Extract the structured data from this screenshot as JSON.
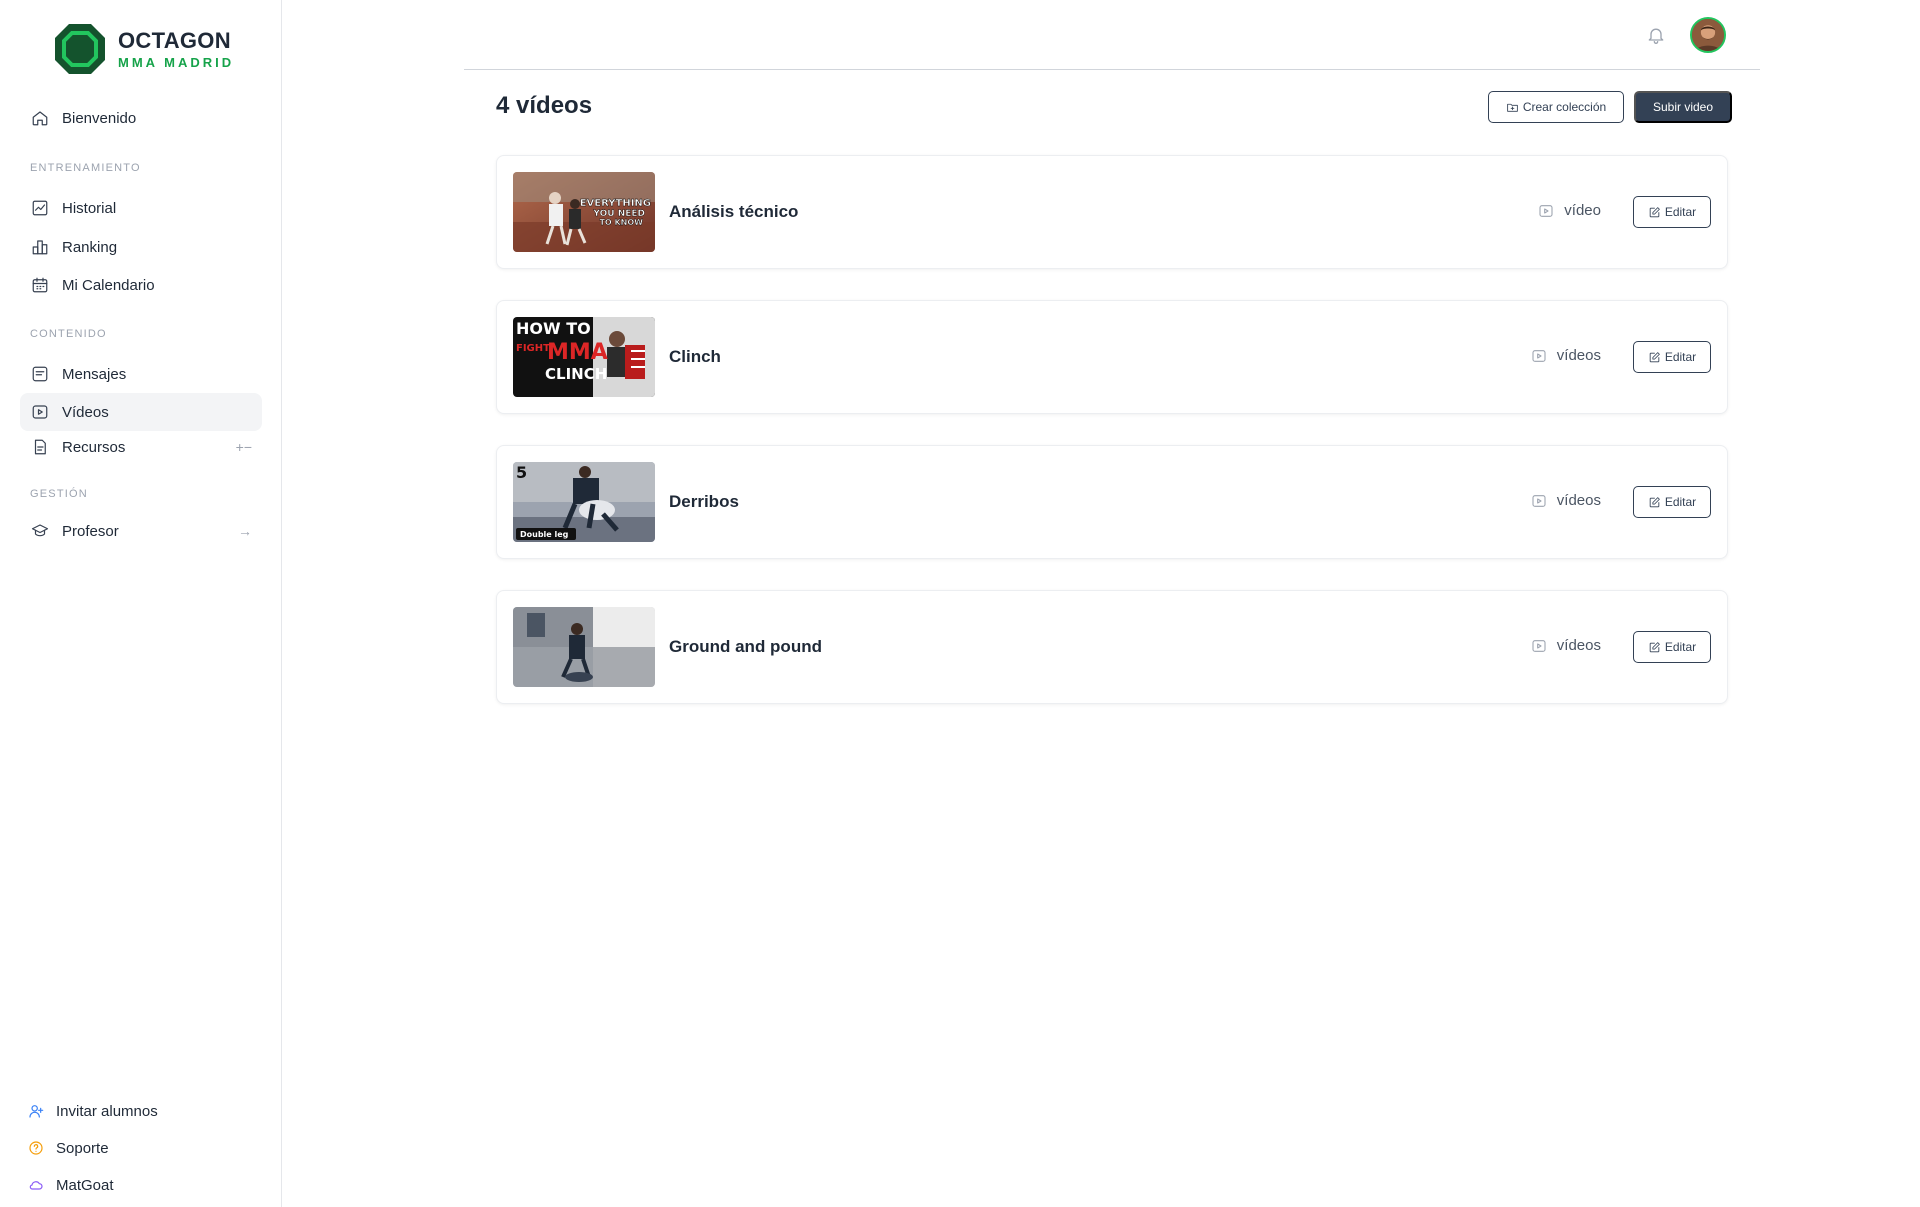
{
  "brand": {
    "title": "OCTAGON",
    "subtitle": "MMA MADRID",
    "accent": "#16a34a"
  },
  "sidebar": {
    "home": {
      "label": "Bienvenido",
      "icon": "home-icon"
    },
    "sections": [
      {
        "label": "ENTRENAMIENTO",
        "items": [
          {
            "label": "Historial",
            "icon": "chart-icon"
          },
          {
            "label": "Ranking",
            "icon": "ranking-icon"
          },
          {
            "label": "Mi Calendario",
            "icon": "calendar-icon"
          }
        ]
      },
      {
        "label": "CONTENIDO",
        "items": [
          {
            "label": "Mensajes",
            "icon": "message-icon"
          },
          {
            "label": "Vídeos",
            "icon": "video-icon",
            "active": true
          },
          {
            "label": "Recursos",
            "icon": "file-icon",
            "trail": "+−"
          }
        ]
      },
      {
        "label": "GESTIÓN",
        "items": [
          {
            "label": "Profesor",
            "icon": "graduation-cap-icon",
            "trail": "→"
          }
        ]
      }
    ],
    "footer": [
      {
        "label": "Invitar alumnos",
        "icon": "user-plus-icon",
        "color": "#3b82f6"
      },
      {
        "label": "Soporte",
        "icon": "help-icon",
        "color": "#f59e0b"
      },
      {
        "label": "MatGoat",
        "icon": "cloud-icon",
        "color": "#8b5cf6"
      }
    ]
  },
  "header": {
    "title": "4 vídeos",
    "create_collection_label": "Crear colección",
    "upload_label": "Subir video"
  },
  "collections": [
    {
      "title": "Análisis técnico",
      "count_label": "vídeo",
      "edit_label": "Editar",
      "thumb_text": [
        "EVERYTHING",
        "YOU NEED",
        "TO KNOW"
      ]
    },
    {
      "title": "Clinch",
      "count_label": "vídeos",
      "edit_label": "Editar",
      "thumb_text": [
        "HOW TO",
        "FIGHT",
        "MMA",
        "CLINCH"
      ]
    },
    {
      "title": "Derribos",
      "count_label": "vídeos",
      "edit_label": "Editar",
      "thumb_text": [
        "5",
        "Double leg"
      ]
    },
    {
      "title": "Ground and pound",
      "count_label": "vídeos",
      "edit_label": "Editar",
      "thumb_text": []
    }
  ]
}
